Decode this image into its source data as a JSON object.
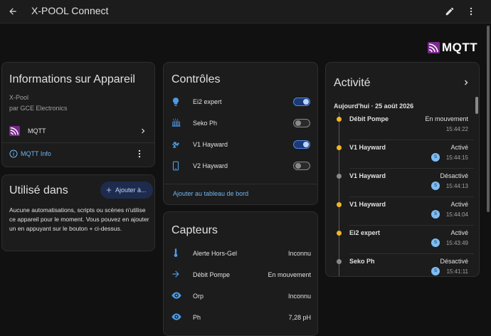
{
  "appbar": {
    "title": "X-POOL Connect",
    "back_icon": "arrow-left-icon",
    "edit_icon": "pencil-icon",
    "more_icon": "dots-vertical-icon"
  },
  "brand": {
    "logo_text": "MQTT",
    "accent": "#7b2a8f"
  },
  "info_card": {
    "title": "Informations sur Appareil",
    "model": "X-Pool",
    "manufacturer": "par GCE Electronics",
    "integration_label": "MQTT",
    "info_link": "MQTT Info"
  },
  "used_card": {
    "title": "Utilisé dans",
    "add_button": "Ajouter à...",
    "description": "Aucune automatisations, scripts ou scènes n'utilise ce appareil pour le moment. Vous pouvez en ajouter un en appuyant sur le bouton + ci-dessus."
  },
  "controls_card": {
    "title": "Contrôles",
    "items": [
      {
        "label": "Ei2 expert",
        "icon": "lightbulb-icon",
        "on": true
      },
      {
        "label": "Seko Ph",
        "icon": "radiator-icon",
        "on": false
      },
      {
        "label": "V1 Hayward",
        "icon": "pump-icon",
        "on": true
      },
      {
        "label": "V2 Hayward",
        "icon": "phone-icon",
        "on": false
      }
    ],
    "dashboard_link": "Ajouter au tableau de bord"
  },
  "sensors_card": {
    "title": "Capteurs",
    "items": [
      {
        "label": "Alerte Hors-Gel",
        "icon": "thermometer-icon",
        "value": "Inconnu"
      },
      {
        "label": "Débit Pompe",
        "icon": "arrow-right-icon",
        "value": "En mouvement"
      },
      {
        "label": "Orp",
        "icon": "eye-icon",
        "value": "Inconnu"
      },
      {
        "label": "Ph",
        "icon": "eye-icon",
        "value": "7,28 pH"
      }
    ]
  },
  "activity_card": {
    "title": "Activité",
    "date": "Aujourd'hui · 25 août 2026",
    "entries": [
      {
        "name": "Débit Pompe",
        "state": "En mouvement",
        "time": "15:44:22",
        "dot": "#f0b626",
        "avatar": ""
      },
      {
        "name": "V1 Hayward",
        "state": "Activé",
        "time": "15:44:15",
        "dot": "#f0b626",
        "avatar": "S"
      },
      {
        "name": "V1 Hayward",
        "state": "Désactivé",
        "time": "15:44:13",
        "dot": "#8a8a8a",
        "avatar": "S"
      },
      {
        "name": "V1 Hayward",
        "state": "Activé",
        "time": "15:44:04",
        "dot": "#f0b626",
        "avatar": "S"
      },
      {
        "name": "Ei2 expert",
        "state": "Activé",
        "time": "15:43:49",
        "dot": "#f0b626",
        "avatar": "S"
      },
      {
        "name": "Seko Ph",
        "state": "Désactivé",
        "time": "15:41:11",
        "dot": "#8a8a8a",
        "avatar": "S"
      }
    ]
  }
}
